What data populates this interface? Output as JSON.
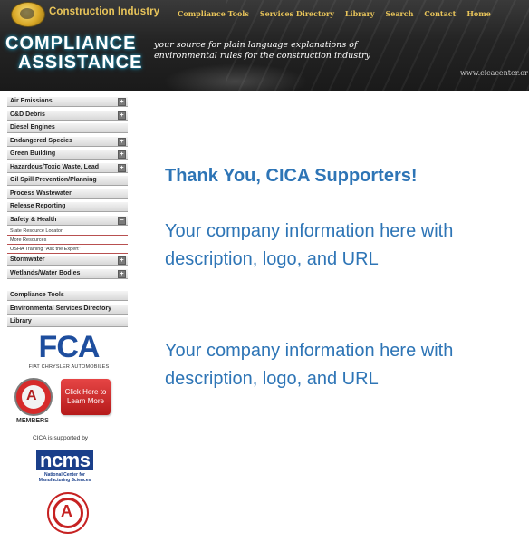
{
  "header": {
    "brand_top": "Construction Industry",
    "brand_line1": "COMPLIANCE",
    "brand_line2": "ASSISTANCE",
    "tagline_line1": "your source for plain language explanations of",
    "tagline_line2": "environmental rules for the construction industry",
    "url": "www.cicacenter.or",
    "nav": [
      "Compliance Tools",
      "Services Directory",
      "Library",
      "Search",
      "Contact",
      "Home"
    ]
  },
  "sidebar": {
    "items": [
      {
        "label": "Air Emissions",
        "toggle": "+"
      },
      {
        "label": "C&D Debris",
        "toggle": "+"
      },
      {
        "label": "Diesel Engines",
        "toggle": ""
      },
      {
        "label": "Endangered Species",
        "toggle": "+"
      },
      {
        "label": "Green Building",
        "toggle": "+"
      },
      {
        "label": "Hazardous/Toxic Waste, Lead",
        "toggle": "+"
      },
      {
        "label": "Oil Spill Prevention/Planning",
        "toggle": ""
      },
      {
        "label": "Process Wastewater",
        "toggle": ""
      },
      {
        "label": "Release Reporting",
        "toggle": ""
      },
      {
        "label": "Safety & Health",
        "toggle": "−"
      }
    ],
    "subitems": [
      "State Resource Locator",
      "More Resources",
      "OSHA Training \"Ask the Expert\""
    ],
    "items_after": [
      {
        "label": "Stormwater",
        "toggle": "+"
      },
      {
        "label": "Wetlands/Water Bodies",
        "toggle": "+"
      }
    ],
    "bottom_items": [
      {
        "label": "Compliance Tools"
      },
      {
        "label": "Environmental Services Directory"
      },
      {
        "label": "Library"
      }
    ],
    "fca_mark": "FCA",
    "fca_sub": "FIAT CHRYSLER AUTOMOBILES",
    "agc_letter": "A",
    "members": "MEMBERS",
    "cta_line1": "Click Here to",
    "cta_line2": "Learn More",
    "supported_by": "CICA is supported by",
    "ncms_mark": "ncms",
    "ncms_sub_line1": "National Center for",
    "ncms_sub_line2": "Manufacturing Sciences",
    "agc_large_letter": "A"
  },
  "main": {
    "heading": "Thank You, CICA Supporters!",
    "sponsors": [
      "Your company information here with description, logo, and URL",
      "Your company information here with description, logo, and URL"
    ]
  },
  "colors": {
    "accent_blue": "#2e75b6",
    "gold": "#e9c55a",
    "header_bg": "#242424"
  }
}
